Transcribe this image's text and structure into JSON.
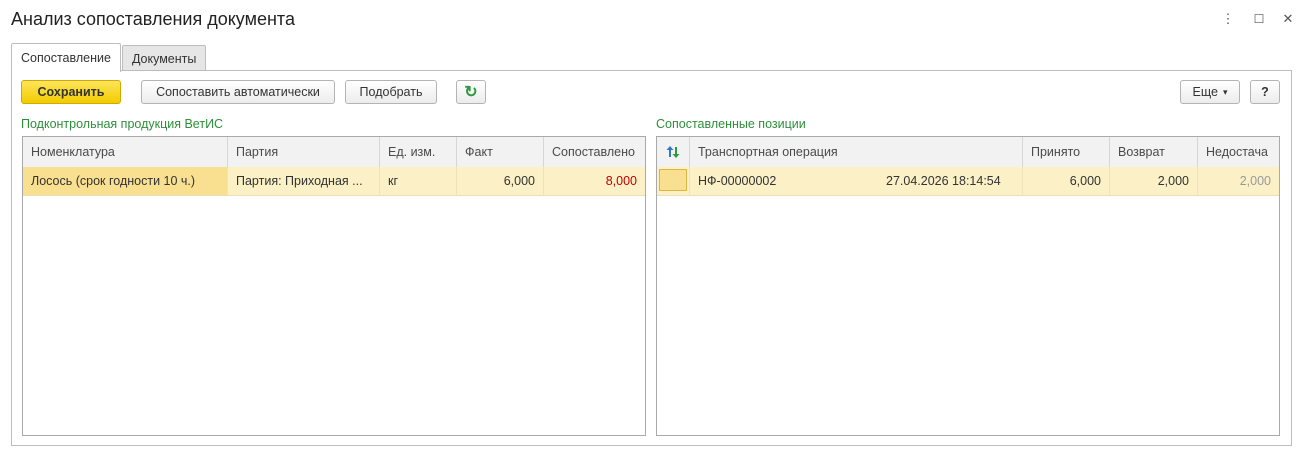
{
  "window": {
    "title": "Анализ сопоставления документа",
    "more_icon": "⋮",
    "maximize_icon": "☐",
    "close_icon": "✕"
  },
  "tabs": [
    {
      "label": "Сопоставление",
      "active": true
    },
    {
      "label": "Документы",
      "active": false
    }
  ],
  "toolbar": {
    "save_label": "Сохранить",
    "auto_match_label": "Сопоставить автоматически",
    "pick_label": "Подобрать",
    "refresh_icon": "↻",
    "more_label": "Еще",
    "more_arrow": "▾",
    "help_label": "?"
  },
  "left_table": {
    "caption": "Подконтрольная продукция ВетИС",
    "columns": [
      "Номенклатура",
      "Партия",
      "Ед. изм.",
      "Факт",
      "Сопоставлено"
    ],
    "rows": [
      {
        "nomenclature": "Лосось (срок годности 10 ч.)",
        "batch": "Партия: Приходная ...",
        "unit": "кг",
        "fact": "6,000",
        "matched": "8,000"
      }
    ]
  },
  "right_table": {
    "caption": "Сопоставленные позиции",
    "columns": [
      "Транспортная операция",
      "Принято",
      "Возврат",
      "Недостача"
    ],
    "rows": [
      {
        "operation": "НФ-00000002",
        "datetime": "27.04.2026 18:14:54",
        "accepted": "6,000",
        "returned": "2,000",
        "shortage": "2,000"
      }
    ]
  },
  "colors": {
    "accent_green": "#2e8f3a",
    "save_yellow": "#f2cc00",
    "matched_red": "#c00000",
    "selected_row": "#fbf0c6"
  }
}
